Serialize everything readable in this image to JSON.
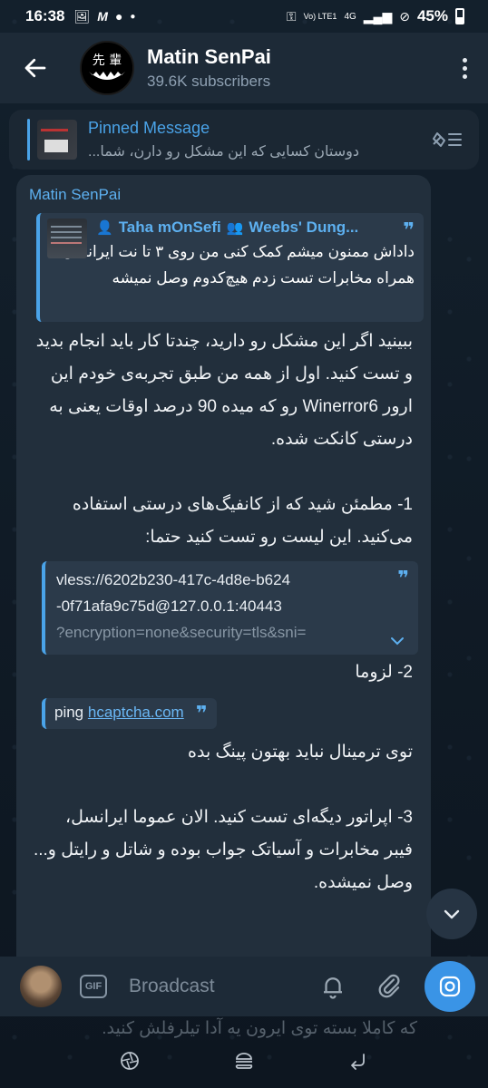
{
  "status": {
    "time": "16:38",
    "left_icons": [
      "gallery-icon",
      "m-icon",
      "account-icon",
      "dot-icon"
    ],
    "net": "Vo) LTE1",
    "net2": "4G",
    "battery": "45%"
  },
  "header": {
    "title": "Matin SenPai",
    "subtitle": "39.6K subscribers",
    "avatar_text": "先 輩"
  },
  "pinned": {
    "label": "Pinned Message",
    "text": "دوستان کسایی که این مشکل رو دارن، شما..."
  },
  "message": {
    "sender": "Matin SenPai",
    "reply": {
      "author": "Taha mOnSefi",
      "group": "Weebs' Dung...",
      "text": "داداش ممنون میشم کمک کنی من روی ۳ تا نت ایرانسل همراه مخابرات تست زدم هیچ‌کدوم وصل نمیشه"
    },
    "body1": "ببینید اگر این مشکل رو دارید، چندتا کار باید انجام بدید و تست کنید. اول از همه من طبق تجربه‌ی خودم این ارور Winerror6 رو که میده 90 درصد اوقات یعنی به درستی کانکت شده.\n\n1- مطمئن شید که از کانفیگ‌های درستی استفاده می‌کنید. این لیست رو تست کنید حتما:",
    "code_line1": "vless://6202b230-417c-4d8e-b624",
    "code_line2": "-0f71afa9c75d@127.0.0.1:40443",
    "code_line3": "?encryption=none&security=tls&sni=",
    "item2": "2- لزوما",
    "ping_cmd": "ping",
    "ping_host": "hcaptcha.com",
    "body2": "توی ترمینال نباید بهتون پینگ بده\n\n3- اپراتور دیگه‌ای تست کنید. الان عموما ایرانسل، فیبر مخابرات و آسیاتک جواب بوده و شاتل و رایتل و... وصل نمیشده."
  },
  "behind_text": "که کاملا بسته توی ایرون یه آدا تیلرفلش کنید.",
  "composer": {
    "gif_label": "GIF",
    "placeholder": "Broadcast"
  },
  "colors": {
    "accent": "#4aa3e8",
    "bubble": "#222f3c",
    "header": "#1d2a37",
    "fab": "#3a94e6"
  }
}
